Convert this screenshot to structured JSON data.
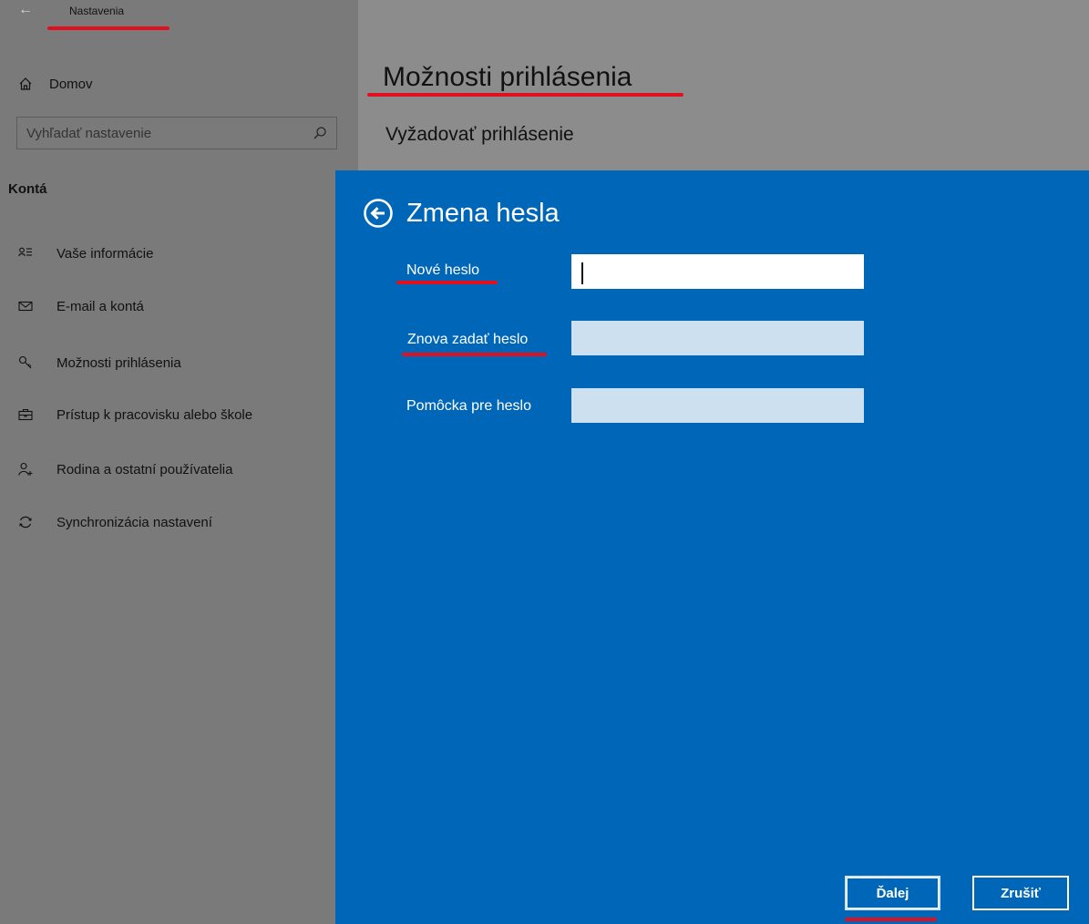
{
  "window": {
    "title": "Nastavenia"
  },
  "sidebar": {
    "home_label": "Domov",
    "search_placeholder": "Vyhľadať nastavenie",
    "section_title": "Kontá",
    "items": [
      {
        "label": "Vaše informácie",
        "icon": "user-info-icon"
      },
      {
        "label": "E-mail a kontá",
        "icon": "mail-icon"
      },
      {
        "label": "Možnosti prihlásenia",
        "icon": "key-icon"
      },
      {
        "label": "Prístup k pracovisku alebo škole",
        "icon": "briefcase-icon"
      },
      {
        "label": "Rodina a ostatní používatelia",
        "icon": "add-person-icon"
      },
      {
        "label": "Synchronizácia nastavení",
        "icon": "sync-icon"
      }
    ]
  },
  "main": {
    "page_title": "Možnosti prihlásenia",
    "subheading": "Vyžadovať prihlásenie"
  },
  "dialog": {
    "title": "Zmena hesla",
    "fields": {
      "new_password": {
        "label": "Nové heslo",
        "value": ""
      },
      "confirm_password": {
        "label": "Znova zadať heslo",
        "value": ""
      },
      "hint": {
        "label": "Pomôcka pre heslo",
        "value": ""
      }
    },
    "next_label": "Ďalej",
    "cancel_label": "Zrušiť"
  },
  "colors": {
    "dialog_bg": "#0067b8",
    "sidebar_dim": "#7a7a7a",
    "main_dim": "#8c8c8c",
    "annotation_red": "#e0101e"
  }
}
